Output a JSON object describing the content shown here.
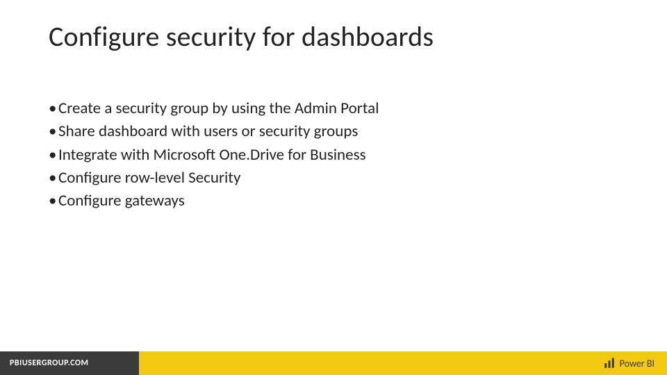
{
  "slide": {
    "title": "Configure security for dashboards",
    "bullets": [
      "Create a security group by using the Admin Portal",
      "Share dashboard with users or security groups",
      "Integrate with Microsoft One.Drive for Business",
      "Configure row-level Security",
      "Configure gateways"
    ]
  },
  "footer": {
    "left_text": "PBIUSERGROUP.COM",
    "right_text": "Power BI"
  },
  "colors": {
    "accent_yellow": "#f2c811",
    "footer_dark": "#3b3b3b"
  }
}
